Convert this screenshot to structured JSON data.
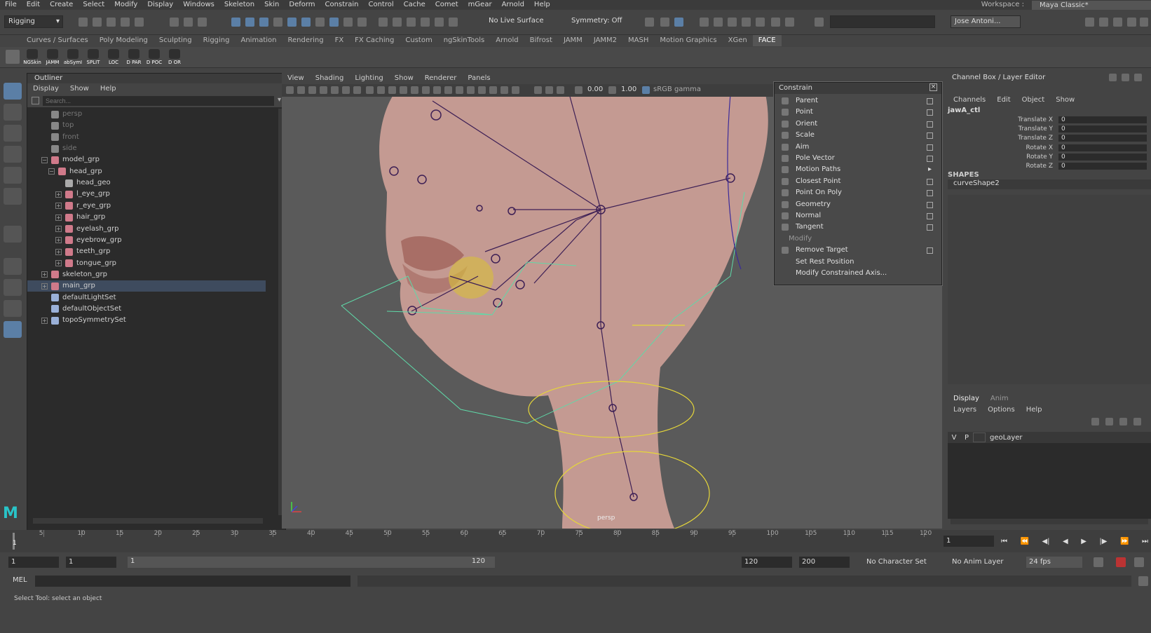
{
  "menubar": {
    "items": [
      "File",
      "Edit",
      "Create",
      "Select",
      "Modify",
      "Display",
      "Windows",
      "Skeleton",
      "Skin",
      "Deform",
      "Constrain",
      "Control",
      "Cache",
      "Comet",
      "mGear",
      "Arnold",
      "Help"
    ],
    "workspace_label": "Workspace :",
    "workspace_value": "Maya Classic*"
  },
  "statusline": {
    "mode": "Rigging",
    "live_surface": "No Live Surface",
    "symmetry": "Symmetry: Off",
    "user": "Jose Antoni..."
  },
  "shelf": {
    "tabs": [
      "Curves / Surfaces",
      "Poly Modeling",
      "Sculpting",
      "Rigging",
      "Animation",
      "Rendering",
      "FX",
      "FX Caching",
      "Custom",
      "ngSkinTools",
      "Arnold",
      "Bifrost",
      "JAMM",
      "JAMM2",
      "MASH",
      "Motion Graphics",
      "XGen",
      "FACE"
    ],
    "active_tab": "FACE",
    "buttons": [
      "NGSkin",
      "JAMM",
      "abSymI",
      "SPLIT",
      "LOC",
      "D PAR",
      "D POC",
      "D OR"
    ]
  },
  "outliner": {
    "title": "Outliner",
    "menu": [
      "Display",
      "Show",
      "Help"
    ],
    "search_placeholder": "Search...",
    "items": [
      {
        "label": "persp",
        "indent": 0,
        "dim": true,
        "exp": ""
      },
      {
        "label": "top",
        "indent": 0,
        "dim": true,
        "exp": ""
      },
      {
        "label": "front",
        "indent": 0,
        "dim": true,
        "exp": ""
      },
      {
        "label": "side",
        "indent": 0,
        "dim": true,
        "exp": ""
      },
      {
        "label": "model_grp",
        "indent": 0,
        "dim": false,
        "exp": "−"
      },
      {
        "label": "head_grp",
        "indent": 1,
        "dim": false,
        "exp": "−"
      },
      {
        "label": "head_geo",
        "indent": 2,
        "dim": false,
        "exp": ""
      },
      {
        "label": "l_eye_grp",
        "indent": 2,
        "dim": false,
        "exp": "+"
      },
      {
        "label": "r_eye_grp",
        "indent": 2,
        "dim": false,
        "exp": "+"
      },
      {
        "label": "hair_grp",
        "indent": 2,
        "dim": false,
        "exp": "+"
      },
      {
        "label": "eyelash_grp",
        "indent": 2,
        "dim": false,
        "exp": "+"
      },
      {
        "label": "eyebrow_grp",
        "indent": 2,
        "dim": false,
        "exp": "+"
      },
      {
        "label": "teeth_grp",
        "indent": 2,
        "dim": false,
        "exp": "+"
      },
      {
        "label": "tongue_grp",
        "indent": 2,
        "dim": false,
        "exp": "+"
      },
      {
        "label": "skeleton_grp",
        "indent": 0,
        "dim": false,
        "exp": "+"
      },
      {
        "label": "main_grp",
        "indent": 0,
        "dim": false,
        "exp": "+",
        "selected": true
      },
      {
        "label": "defaultLightSet",
        "indent": 0,
        "dim": false,
        "exp": ""
      },
      {
        "label": "defaultObjectSet",
        "indent": 0,
        "dim": false,
        "exp": ""
      },
      {
        "label": "topoSymmetrySet",
        "indent": 0,
        "dim": false,
        "exp": "+"
      }
    ]
  },
  "viewport": {
    "menu": [
      "View",
      "Shading",
      "Lighting",
      "Show",
      "Renderer",
      "Panels"
    ],
    "exposure": "0.00",
    "gamma": "1.00",
    "colorspace": "sRGB gamma",
    "camera": "persp"
  },
  "constrain": {
    "title": "Constrain",
    "items": [
      {
        "label": "Parent",
        "type": "check"
      },
      {
        "label": "Point",
        "type": "check"
      },
      {
        "label": "Orient",
        "type": "check"
      },
      {
        "label": "Scale",
        "type": "check"
      },
      {
        "label": "Aim",
        "type": "check"
      },
      {
        "label": "Pole Vector",
        "type": "check"
      },
      {
        "label": "Motion Paths",
        "type": "sub"
      },
      {
        "label": "Closest Point",
        "type": "check"
      },
      {
        "label": "Point On Poly",
        "type": "check"
      },
      {
        "label": "Geometry",
        "type": "check"
      },
      {
        "label": "Normal",
        "type": "check"
      },
      {
        "label": "Tangent",
        "type": "check"
      },
      {
        "label": "Modify",
        "type": "section"
      },
      {
        "label": "Remove Target",
        "type": "check"
      },
      {
        "label": "Set Rest Position",
        "type": "plain"
      },
      {
        "label": "Modify Constrained Axis...",
        "type": "plain"
      }
    ]
  },
  "channelbox": {
    "title": "Channel Box / Layer Editor",
    "menu": [
      "Channels",
      "Edit",
      "Object",
      "Show"
    ],
    "object": "jawA_ctl",
    "channels": [
      {
        "name": "Translate X",
        "value": "0"
      },
      {
        "name": "Translate Y",
        "value": "0"
      },
      {
        "name": "Translate Z",
        "value": "0"
      },
      {
        "name": "Rotate X",
        "value": "0"
      },
      {
        "name": "Rotate Y",
        "value": "0"
      },
      {
        "name": "Rotate Z",
        "value": "0"
      }
    ],
    "shapes_label": "SHAPES",
    "shape": "curveShape2"
  },
  "layers": {
    "tabs": [
      "Display",
      "Anim"
    ],
    "menu": [
      "Layers",
      "Options",
      "Help"
    ],
    "layer": {
      "v": "V",
      "p": "P",
      "name": "geoLayer"
    }
  },
  "timeline": {
    "ticks": [
      "5",
      "10",
      "15",
      "20",
      "25",
      "30",
      "35",
      "40",
      "45",
      "50",
      "55",
      "60",
      "65",
      "70",
      "75",
      "80",
      "85",
      "90",
      "95",
      "100",
      "105",
      "110",
      "115",
      "120"
    ],
    "current_frame": "1",
    "current_field": "1"
  },
  "range": {
    "start": "1",
    "start2": "1",
    "slider_start": "1",
    "slider_end": "120",
    "end": "120",
    "end2": "200",
    "character_set": "No Character Set",
    "anim_layer": "No Anim Layer",
    "fps": "24 fps"
  },
  "cmdline": {
    "lang": "MEL"
  },
  "helpline": {
    "text": "Select Tool: select an object"
  }
}
